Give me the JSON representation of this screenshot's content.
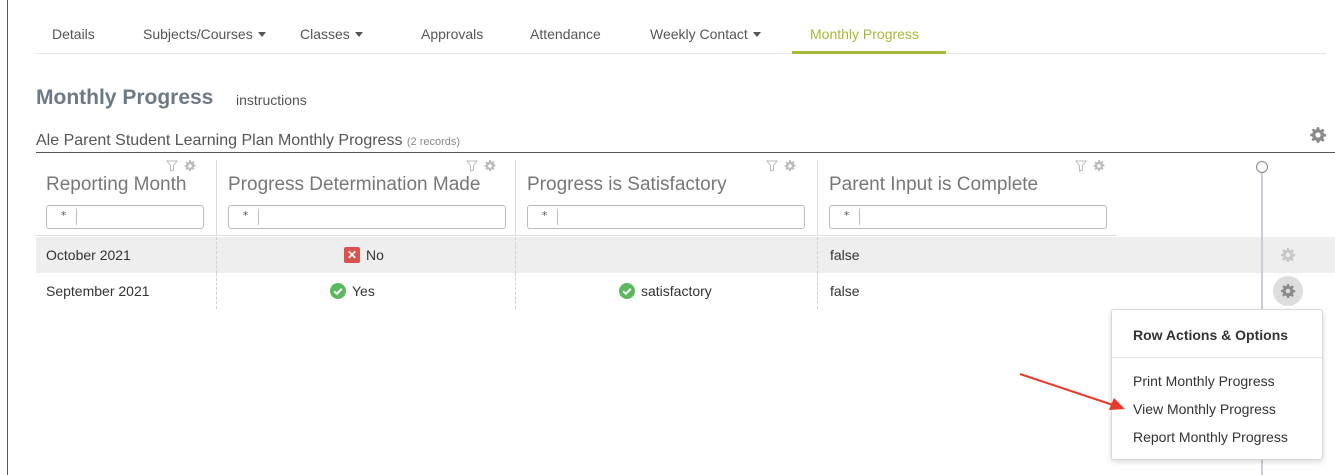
{
  "tabs": [
    {
      "label": "Details"
    },
    {
      "label": "Subjects/Courses"
    },
    {
      "label": "Classes"
    },
    {
      "label": "Approvals"
    },
    {
      "label": "Attendance"
    },
    {
      "label": "Weekly Contact"
    },
    {
      "label": "Monthly Progress"
    }
  ],
  "page": {
    "title": "Monthly Progress",
    "instructions_link": "instructions"
  },
  "grid": {
    "title": "Ale Parent Student Learning Plan Monthly Progress",
    "count": "(2 records)",
    "columns": [
      {
        "label": "Reporting Month",
        "filter_op": "*"
      },
      {
        "label": "Progress Determination Made",
        "filter_op": "*"
      },
      {
        "label": "Progress is Satisfactory",
        "filter_op": "*"
      },
      {
        "label": "Parent Input is Complete",
        "filter_op": "*"
      }
    ],
    "rows": [
      {
        "reporting_month": "October 2021",
        "progress_made": "No",
        "satisfactory": "",
        "parent_input": "false"
      },
      {
        "reporting_month": "September 2021",
        "progress_made": "Yes",
        "satisfactory": "satisfactory",
        "parent_input": "false"
      }
    ]
  },
  "row_menu": {
    "header": "Row Actions & Options",
    "items": [
      {
        "label": "Print Monthly Progress"
      },
      {
        "label": "View Monthly Progress"
      },
      {
        "label": "Report Monthly Progress"
      }
    ]
  },
  "icons": {
    "filter": "filter-funnel-icon",
    "settings": "gear-icon",
    "no": "red-x-icon",
    "yes": "green-check-icon",
    "annotation": "red-arrow"
  },
  "colors": {
    "accent": "#a8b934",
    "title": "#6b7a85",
    "no_badge": "#d9534f",
    "yes_badge": "#5cb85c",
    "annotation_arrow": "#e8392b",
    "row_stripe": "#eeeeee"
  }
}
